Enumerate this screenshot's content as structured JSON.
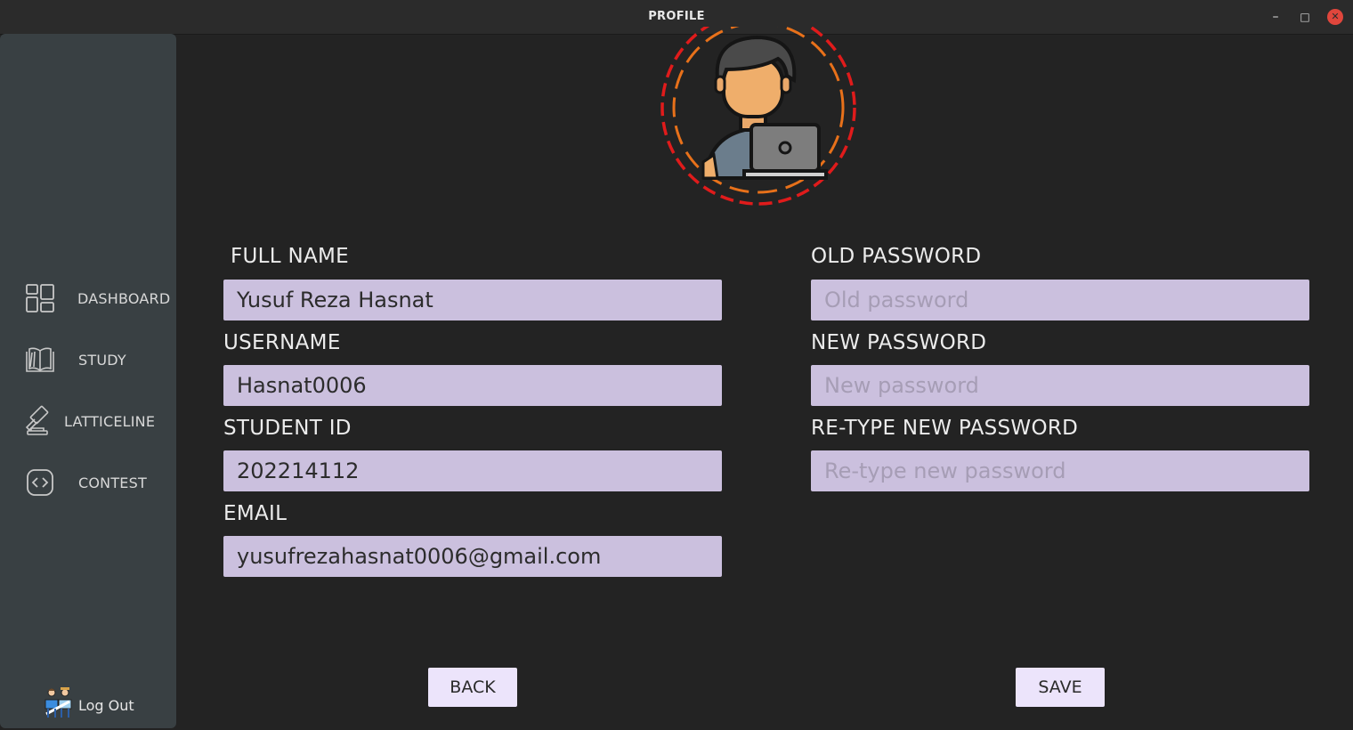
{
  "window": {
    "title": "PROFILE",
    "minimize": "–",
    "maximize": "□",
    "close": "✕"
  },
  "sidebar": {
    "items": [
      {
        "label": "DASHBOARD",
        "icon": "dashboard-icon"
      },
      {
        "label": "STUDY",
        "icon": "book-icon"
      },
      {
        "label": "LATTICELINE",
        "icon": "gavel-icon"
      },
      {
        "label": "CONTEST",
        "icon": "code-icon"
      }
    ],
    "logout": {
      "label": "Log Out",
      "icon": "logout-people-icon"
    }
  },
  "profile": {
    "avatar": "user-laptop-avatar",
    "full_name": {
      "label": "FULL NAME",
      "value": "Yusuf Reza Hasnat"
    },
    "username": {
      "label": "USERNAME",
      "value": "Hasnat0006"
    },
    "student_id": {
      "label": "STUDENT ID",
      "value": "202214112"
    },
    "email": {
      "label": "EMAIL",
      "value": "yusufrezahasnat0006@gmail.com"
    },
    "old_password": {
      "label": "OLD PASSWORD",
      "placeholder": "Old password"
    },
    "new_password": {
      "label": "NEW PASSWORD",
      "placeholder": "New password"
    },
    "retype_password": {
      "label": "RE-TYPE NEW PASSWORD",
      "placeholder": "Re-type new password"
    }
  },
  "actions": {
    "back": "BACK",
    "save": "SAVE"
  },
  "colors": {
    "background": "#232323",
    "sidebar": "#394043",
    "input": "#cbc0de",
    "button": "#ece4fb",
    "avatar_ring_outer": "#e01b1b",
    "avatar_ring_inner": "#e8711a"
  }
}
